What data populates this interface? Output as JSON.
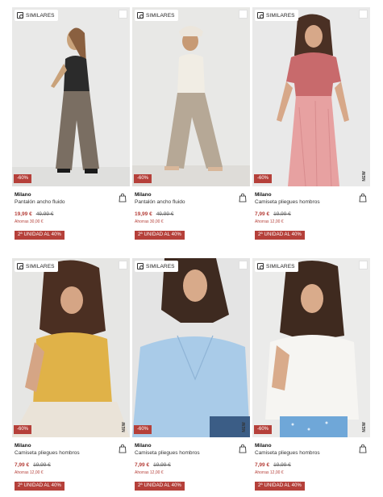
{
  "ui": {
    "similar_label": "SIMILARES",
    "new_label": "NEW",
    "colors": {
      "accent": "#b5403a",
      "background": "#ffffff"
    }
  },
  "products": [
    {
      "brand": "Milano",
      "name": "Pantalón ancho fluido",
      "discount": "-60%",
      "price": "19,99 €",
      "old_price": "49,99 €",
      "savings": "Ahorras 30,00 €",
      "promo": "2ª UNIDAD AL 40%",
      "is_new": false
    },
    {
      "brand": "Milano",
      "name": "Pantalón ancho fluido",
      "discount": "-60%",
      "price": "19,99 €",
      "old_price": "49,99 €",
      "savings": "Ahorras 30,00 €",
      "promo": "2ª UNIDAD AL 40%",
      "is_new": false
    },
    {
      "brand": "Milano",
      "name": "Camiseta pliegues hombros",
      "discount": "-60%",
      "price": "7,99 €",
      "old_price": "19,99 €",
      "savings": "Ahorras 12,00 €",
      "promo": "2ª UNIDAD AL 40%",
      "is_new": true
    },
    {
      "brand": "Milano",
      "name": "Camiseta pliegues hombros",
      "discount": "-60%",
      "price": "7,99 €",
      "old_price": "19,99 €",
      "savings": "Ahorras 12,00 €",
      "promo": "2ª UNIDAD AL 40%",
      "is_new": true
    },
    {
      "brand": "Milano",
      "name": "Camiseta pliegues hombros",
      "discount": "-60%",
      "price": "7,99 €",
      "old_price": "19,99 €",
      "savings": "Ahorras 12,00 €",
      "promo": "2ª UNIDAD AL 40%",
      "is_new": true
    },
    {
      "brand": "Milano",
      "name": "Camiseta pliegues hombros",
      "discount": "-60%",
      "price": "7,99 €",
      "old_price": "19,99 €",
      "savings": "Ahorras 12,00 €",
      "promo": "2ª UNIDAD AL 40%",
      "is_new": true
    }
  ]
}
